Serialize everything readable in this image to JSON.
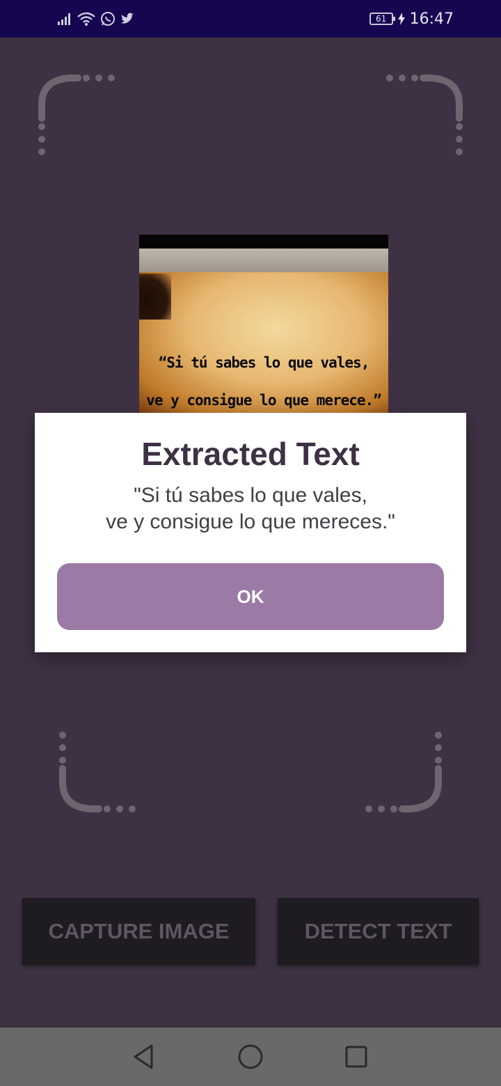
{
  "status_bar": {
    "time": "16:47",
    "battery_level": "61",
    "icons": [
      "signal-icon",
      "wifi-icon",
      "whatsapp-icon",
      "twitter-icon",
      "battery-icon",
      "charging-icon"
    ]
  },
  "preview": {
    "line1": "“Si tú sabes lo que vales,",
    "line2": "ve y consigue lo que merece.”"
  },
  "buttons": {
    "capture_label": "CAPTURE IMAGE",
    "detect_label": "DETECT TEXT"
  },
  "dialog": {
    "title": "Extracted Text",
    "message": "\"Si tú sabes lo que vales,\nve y consigue lo que mereces.\"",
    "ok_label": "OK"
  },
  "nav": {
    "icons": [
      "back-icon",
      "home-icon",
      "recents-icon"
    ]
  },
  "colors": {
    "status_bar_bg": "#160550",
    "app_bg": "#3e3143",
    "ok_button": "#9b7aa5",
    "dark_button": "#1e1b21",
    "nav_bar_bg": "#696969"
  }
}
